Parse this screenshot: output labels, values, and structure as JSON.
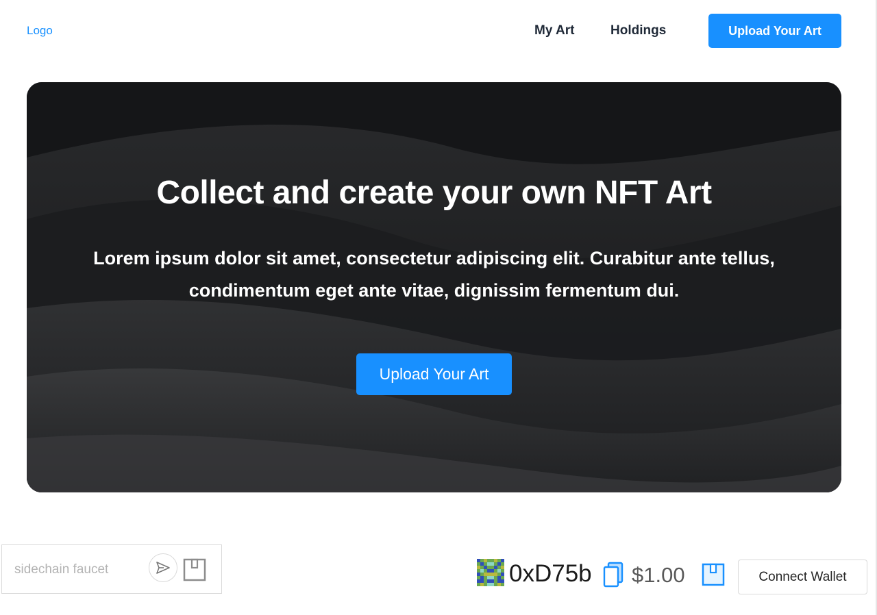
{
  "nav": {
    "logo": "Logo",
    "links": [
      "My Art",
      "Holdings"
    ],
    "upload_label": "Upload Your Art"
  },
  "hero": {
    "title": "Collect and create your own NFT Art",
    "subtitle": "Lorem ipsum dolor sit amet, consectetur adipiscing elit. Curabitur ante tellus, condimentum eget ante vitae, dignissim fermentum dui.",
    "cta_label": "Upload Your Art"
  },
  "faucet": {
    "placeholder": "sidechain faucet",
    "value": "",
    "send_icon": "send-icon",
    "wallet_icon": "wallet-icon"
  },
  "wallet": {
    "address": "0xD75b",
    "balance": "$1.00",
    "copy_icon": "copy-icon",
    "wallet_icon": "wallet-icon",
    "connect_label": "Connect Wallet"
  },
  "colors": {
    "accent": "#1890ff",
    "text_dark": "#1f2937",
    "hero_bg": "#1a1b1d"
  }
}
